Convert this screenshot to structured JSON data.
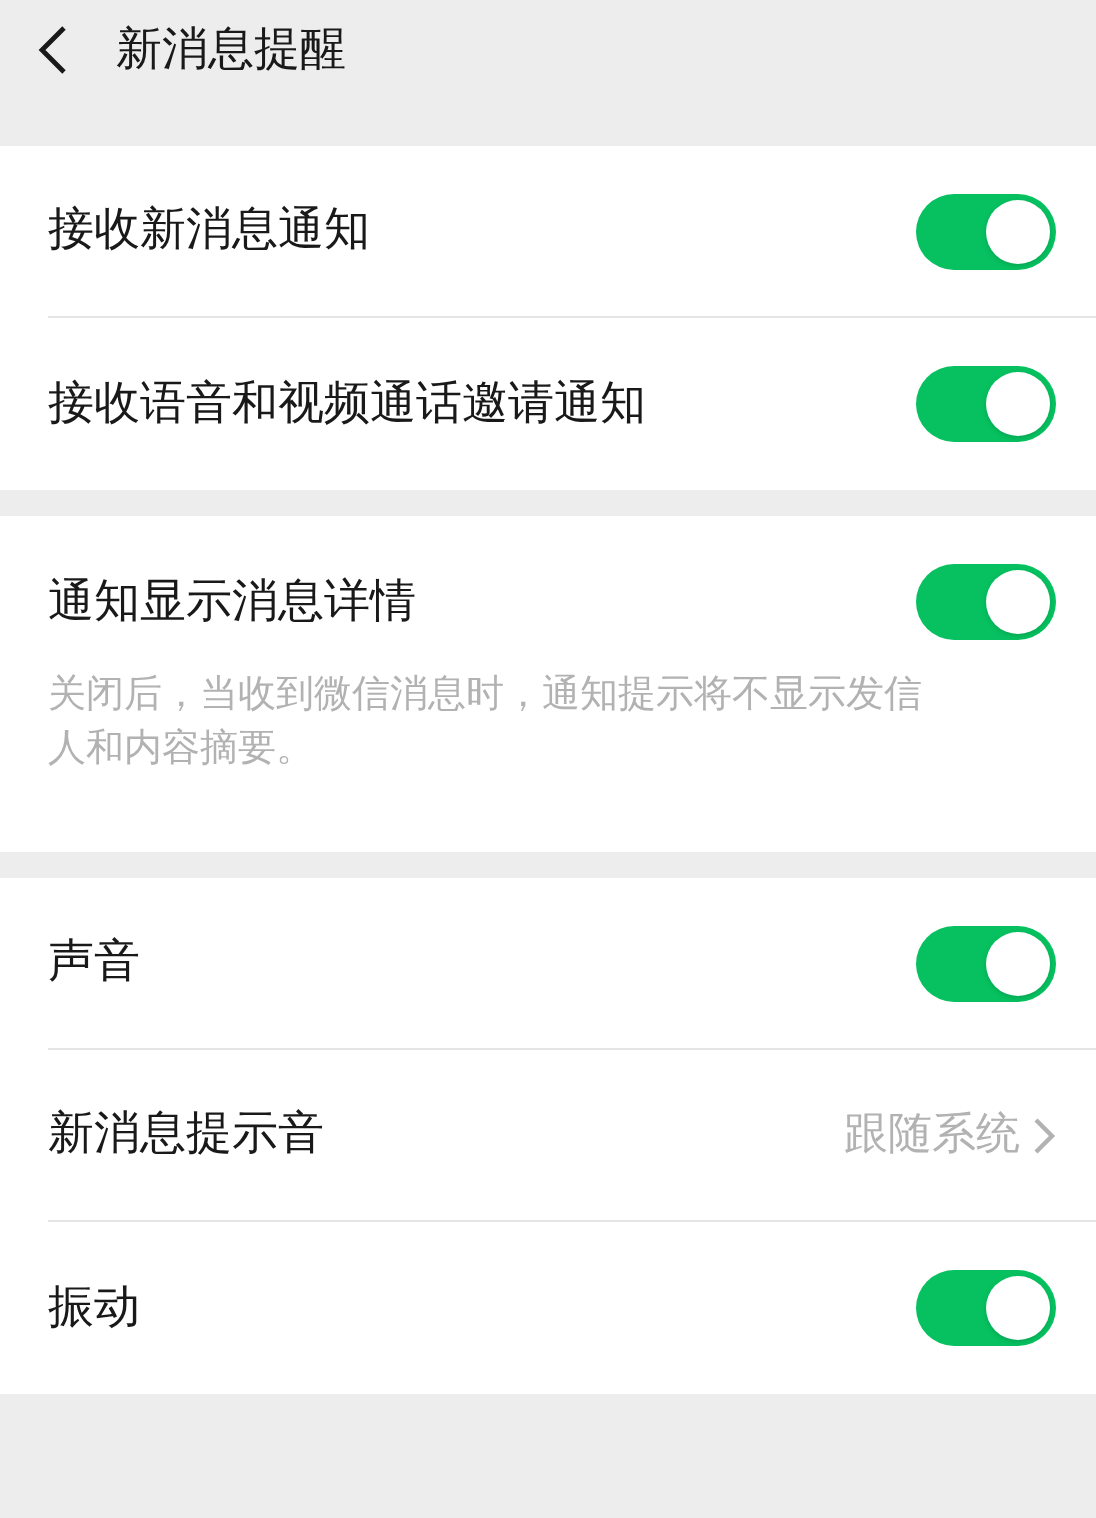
{
  "header": {
    "title": "新消息提醒"
  },
  "sections": [
    {
      "items": [
        {
          "kind": "toggle",
          "label": "接收新消息通知",
          "on": true
        },
        {
          "kind": "toggle",
          "label": "接收语音和视频通话邀请通知",
          "on": true
        }
      ]
    },
    {
      "items": [
        {
          "kind": "toggle",
          "label": "通知显示消息详情",
          "on": true,
          "description": "关闭后，当收到微信消息时，通知提示将不显示发信人和内容摘要。"
        }
      ]
    },
    {
      "items": [
        {
          "kind": "toggle",
          "label": "声音",
          "on": true
        },
        {
          "kind": "link",
          "label": "新消息提示音",
          "value": "跟随系统"
        },
        {
          "kind": "toggle",
          "label": "振动",
          "on": true
        }
      ]
    }
  ]
}
